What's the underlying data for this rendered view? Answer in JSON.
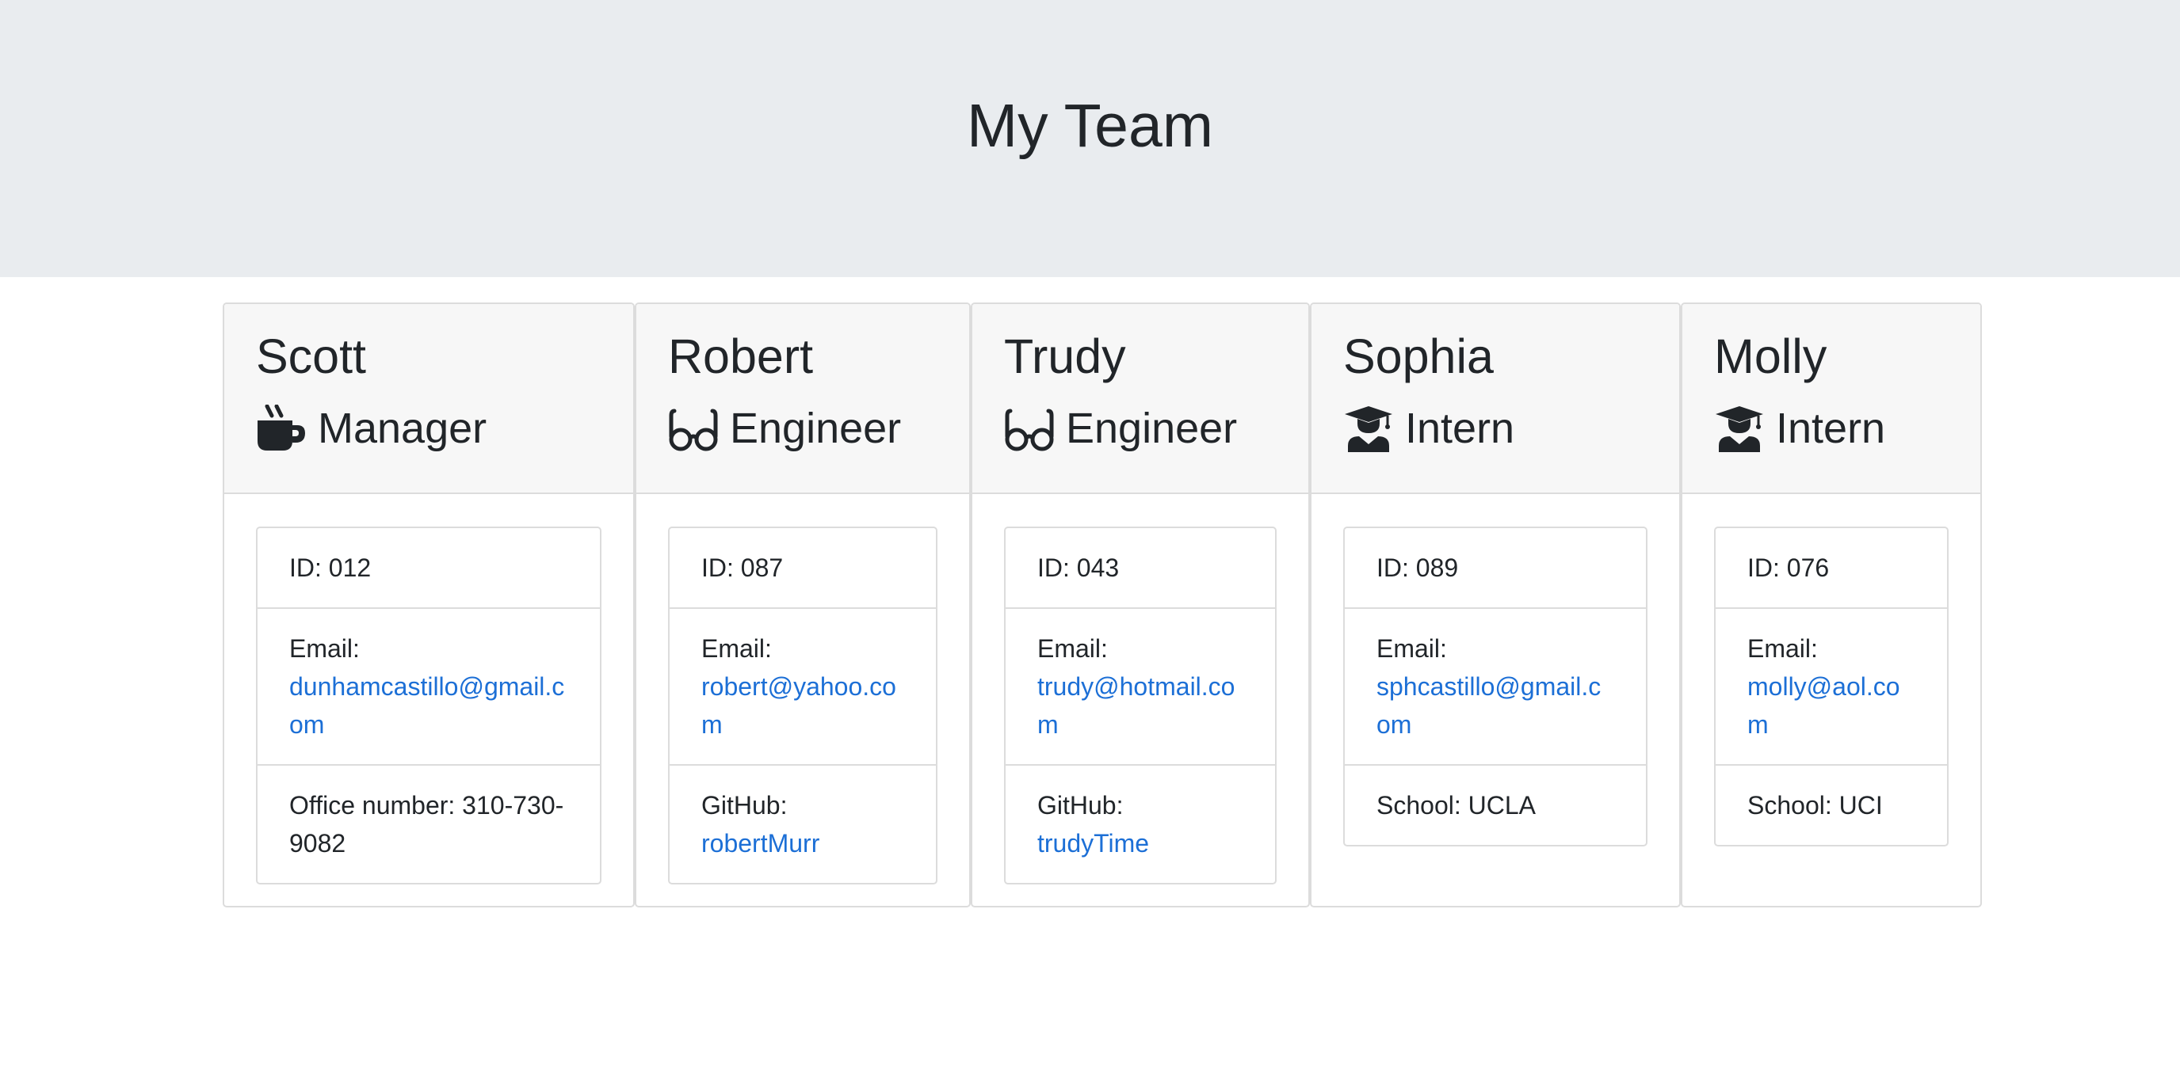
{
  "header": {
    "title": "My Team"
  },
  "employees": [
    {
      "name": "Scott",
      "role": "Manager",
      "icon": "coffee-icon",
      "id_text": "ID: 012",
      "email_label": "Email:",
      "email": "dunhamcastillo@gmail.com",
      "extra_text": "Office number: 310-730-9082"
    },
    {
      "name": "Robert",
      "role": "Engineer",
      "icon": "glasses-icon",
      "id_text": "ID: 087",
      "email_label": "Email:",
      "email": "robert@yahoo.com",
      "extra_label": "GitHub:",
      "extra_link": "robertMurr"
    },
    {
      "name": "Trudy",
      "role": "Engineer",
      "icon": "glasses-icon",
      "id_text": "ID: 043",
      "email_label": "Email:",
      "email": "trudy@hotmail.com",
      "extra_label": "GitHub:",
      "extra_link": "trudyTime"
    },
    {
      "name": "Sophia",
      "role": "Intern",
      "icon": "graduate-icon",
      "id_text": "ID: 089",
      "email_label": "Email:",
      "email": "sphcastillo@gmail.com",
      "extra_text": "School: UCLA"
    },
    {
      "name": "Molly",
      "role": "Intern",
      "icon": "graduate-icon",
      "id_text": "ID: 076",
      "email_label": "Email:",
      "email": "molly@aol.com",
      "extra_text": "School: UCI"
    }
  ],
  "colors": {
    "link": "#1c6fd6",
    "jumbotron": "#e9ecef",
    "card_header": "#f7f7f7"
  }
}
